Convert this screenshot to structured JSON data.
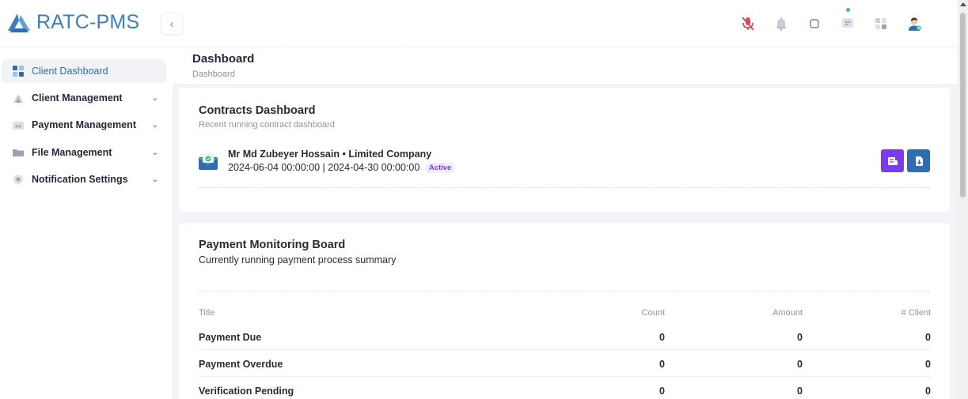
{
  "header": {
    "brand": "RATC-PMS",
    "collapse_icon": "chevron-left-icon",
    "icons": [
      "mic-off-icon",
      "bell-icon",
      "stop-icon",
      "chat-icon",
      "apps-grid-icon",
      "user-avatar"
    ],
    "colors": {
      "brand": "#3a7ec6",
      "mic_off": "#e0455a",
      "online_dot": "#3cc67a"
    }
  },
  "sidebar": {
    "items": [
      {
        "label": "Client Dashboard",
        "icon": "dashboard-icon",
        "active": true
      },
      {
        "label": "Client Management",
        "icon": "client-icon",
        "expandable": true
      },
      {
        "label": "Payment Management",
        "icon": "payment-icon",
        "expandable": true
      },
      {
        "label": "File Management",
        "icon": "folder-icon",
        "expandable": true
      },
      {
        "label": "Notification Settings",
        "icon": "settings-icon",
        "expandable": true
      }
    ]
  },
  "page": {
    "title": "Dashboard",
    "breadcrumb": "Dashboard"
  },
  "contracts": {
    "title": "Contracts Dashboard",
    "subtitle": "Recent running contract dashboard",
    "items": [
      {
        "name": "Mr Md Zubeyer Hossain • Limited Company",
        "dates": "2024-06-04 00:00:00 | 2024-04-30 00:00:00",
        "status": "Active"
      }
    ],
    "colors": {
      "badge": "#7c3aed",
      "btn1": "#7c3aed",
      "btn2": "#2f6db3"
    }
  },
  "payments": {
    "title": "Payment Monitoring Board",
    "subtitle": "Currently running payment process summary",
    "columns": [
      "Title",
      "Count",
      "Amount",
      "# Client"
    ],
    "rows": [
      [
        "Payment Due",
        "0",
        "0",
        "0"
      ],
      [
        "Payment Overdue",
        "0",
        "0",
        "0"
      ],
      [
        "Verification Pending",
        "0",
        "0",
        "0"
      ]
    ]
  }
}
